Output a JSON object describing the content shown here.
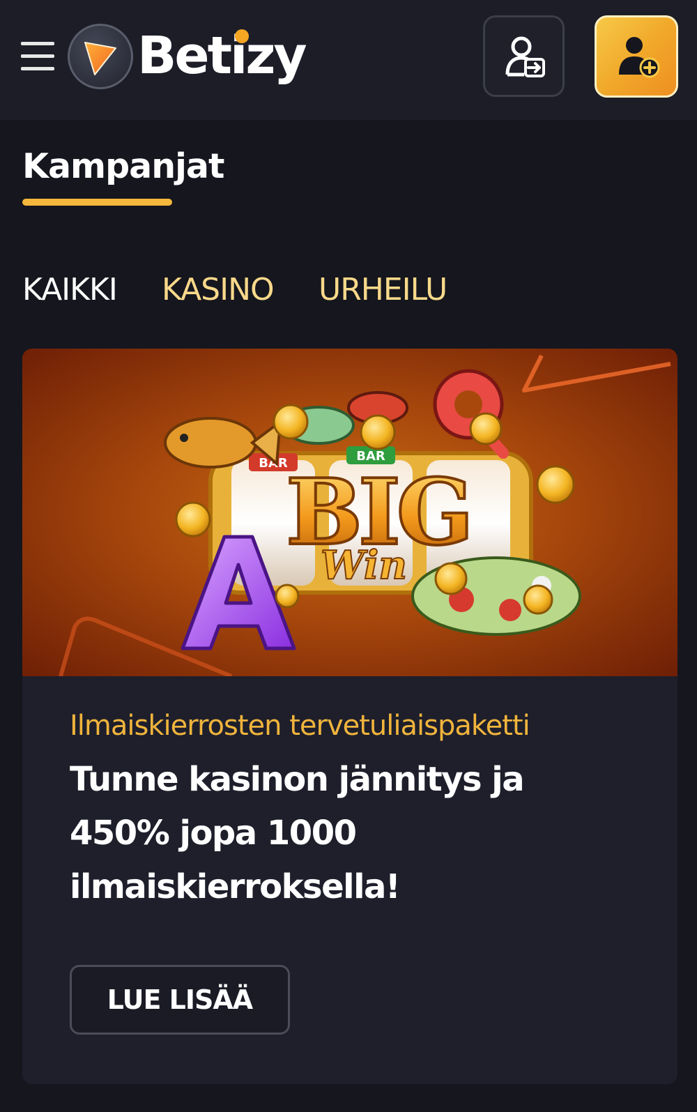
{
  "header": {
    "logo_text": "Betizy",
    "menu_icon": "hamburger-menu-icon",
    "login_icon": "user-login-icon",
    "register_icon": "user-add-icon",
    "accent_color": "#f5b73c"
  },
  "page": {
    "title": "Kampanjat"
  },
  "tabs": [
    {
      "label": "KAIKKI",
      "active": true
    },
    {
      "label": "KASINO",
      "active": false
    },
    {
      "label": "URHEILU",
      "active": false
    }
  ],
  "promo": {
    "banner_logo_text": "BIG",
    "banner_script_text": "Win",
    "subtitle": "Ilmaiskierrosten tervetuliaispaketti",
    "headline_lines": [
      "Tunne kasinon jännitys ja",
      "450% jopa 1000",
      "ilmaiskierroksella!"
    ],
    "button_label": "LUE LISÄÄ"
  }
}
